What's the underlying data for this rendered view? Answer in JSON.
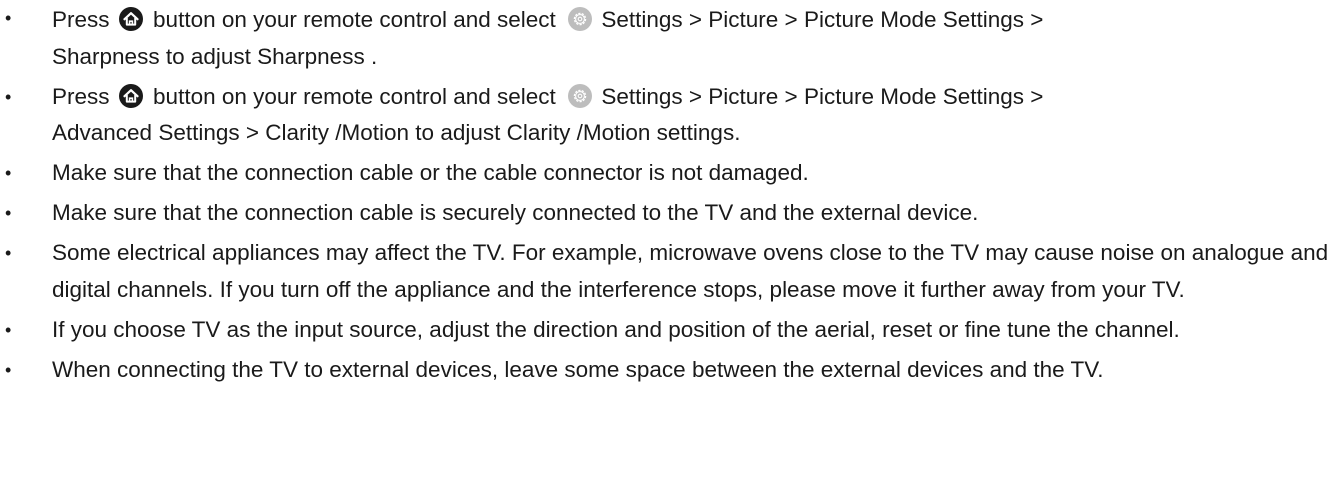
{
  "icons": {
    "home": "home-icon",
    "settings": "gear-icon"
  },
  "colors": {
    "text": "#1a1a1a",
    "home_icon_bg": "#1a1a1a",
    "settings_icon_bg": "#bdbdbd"
  },
  "items": [
    {
      "bullet": "•",
      "press": "Press",
      "after_home": "button on your remote control and select",
      "after_settings": "Settings  > Picture  > Picture Mode Settings >",
      "line2": "Sharpness  to adjust Sharpness ."
    },
    {
      "bullet": "•",
      "press": "Press",
      "after_home": "button on your remote control and select",
      "after_settings": "Settings  > Picture  > Picture Mode Settings >",
      "line2": "Advanced Settings   > Clarity /Motion  to adjust Clarity /Motion  settings."
    },
    {
      "bullet": "•",
      "text": "Make sure that the connection cable or the cable connector is not damaged."
    },
    {
      "bullet": "•",
      "text": "Make sure that the connection cable is securely connected to the TV and the external device."
    },
    {
      "bullet": "•",
      "text": "Some electrical appliances may affect the TV. For example, microwave ovens close to the TV may cause noise on analogue and digital channels. If you turn off the appliance and the interference stops, please move it further away from your TV."
    },
    {
      "bullet": "•",
      "text": "If you choose TV as the input source, adjust the direction and position of the aerial, reset or fine tune the channel."
    },
    {
      "bullet": "•",
      "text": "When connecting the TV to external devices, leave some space between the external devices and the TV."
    }
  ]
}
